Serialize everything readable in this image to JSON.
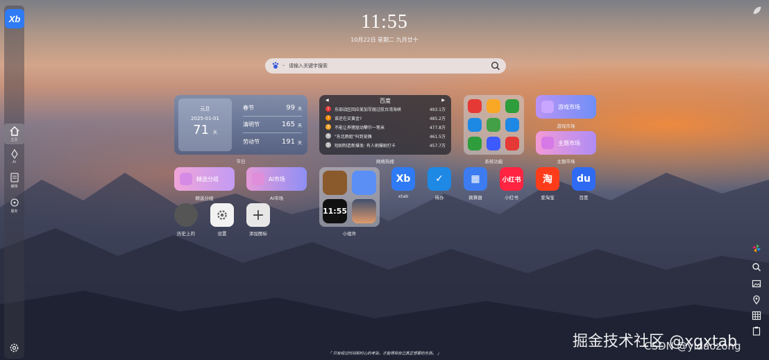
{
  "app": {
    "logo_text": "Xb",
    "brand_color": "#2f7bf5"
  },
  "sidebar": {
    "items": [
      {
        "label": "主页",
        "icon": "home-icon",
        "active": true
      },
      {
        "label": "AI",
        "icon": "sparkle-icon"
      },
      {
        "label": "编辑",
        "icon": "note-icon"
      },
      {
        "label": "服务",
        "icon": "service-icon"
      }
    ],
    "settings_icon": "gear-icon"
  },
  "clock": {
    "time": "11:55",
    "date": "10月22日 星期二 九月廿十"
  },
  "search": {
    "placeholder": "请输入关键字搜索",
    "engine_icon": "baidu-paw-icon"
  },
  "holiday": {
    "caption": "节日",
    "main": {
      "name": "元旦",
      "date": "2025-01-01",
      "count": "71",
      "unit": "天"
    },
    "rows": [
      {
        "name": "春节",
        "value": "99",
        "unit": "天"
      },
      {
        "name": "清明节",
        "value": "165",
        "unit": "天"
      },
      {
        "name": "劳动节",
        "value": "191",
        "unit": "天"
      }
    ]
  },
  "hot": {
    "title": "百度",
    "caption": "网络热搜",
    "items": [
      {
        "rank": "1",
        "text": "东部战区回应美加军舰过航台湾海峡",
        "value": "493.1万",
        "color": "#e53935"
      },
      {
        "rank": "2",
        "text": "谁还在买黄金?",
        "value": "485.2万",
        "color": "#fb8c00"
      },
      {
        "rank": "3",
        "text": "不能让养猪驱动攀尔一笔米",
        "value": "477.8万",
        "color": "#f9a825"
      },
      {
        "rank": "4",
        "text": "\"东北雨姐\"叫到宠偶",
        "value": "461.5万",
        "color": "#bdbdbd"
      },
      {
        "rank": "5",
        "text": "短剧制造新爆发: 有人刷爆剧打卡",
        "value": "457.7万",
        "color": "#bdbdbd"
      }
    ]
  },
  "sysfn": {
    "caption": "系统功能"
  },
  "pills": {
    "game": {
      "label": "游戏市场",
      "caption": "游戏市场"
    },
    "theme": {
      "label": "主题市场",
      "caption": "主题市场"
    },
    "featured": {
      "label": "精选分组",
      "caption": "精选分组"
    },
    "ai": {
      "label": "AI市场",
      "caption": "AI市场"
    }
  },
  "widgets": {
    "caption": "小组件",
    "clock_text": "11:55"
  },
  "apps": [
    {
      "label": "xtab",
      "text": "Xb",
      "color": "#2f7bf5"
    },
    {
      "label": "待办",
      "text": "✓",
      "color": "#1e88e5"
    },
    {
      "label": "换算器",
      "text": "▦",
      "color": "#3d7cf0"
    },
    {
      "label": "小红书",
      "text": "小红书",
      "color": "#ff2442"
    },
    {
      "label": "爱淘宝",
      "text": "淘",
      "color": "#ff3c1a"
    },
    {
      "label": "百度",
      "text": "du",
      "color": "#2f6bf2"
    }
  ],
  "row3": [
    {
      "label": "历史上的"
    },
    {
      "label": "设置"
    },
    {
      "label": "添加图标"
    }
  ],
  "quote": "「 只有经过时间和时心的考验，才能得到自己真正想要的东西。 」",
  "watermark": {
    "line1": "掘金技术社区 @xgxtab",
    "line2": "CSDN @yidaozong"
  }
}
